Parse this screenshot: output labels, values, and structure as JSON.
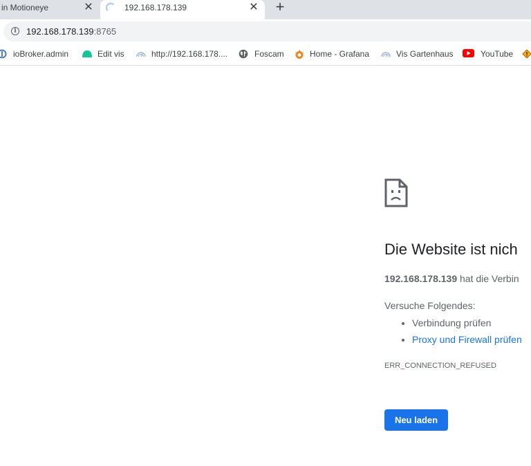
{
  "tabs": [
    {
      "title": "in Motioneye",
      "active": false
    },
    {
      "title": "192.168.178.139",
      "active": true
    }
  ],
  "new_tab_label": "+",
  "address_bar": {
    "host": "192.168.178.139",
    "port": ":8765"
  },
  "bookmarks": [
    {
      "label": "ioBroker.admin",
      "icon": "iobroker-icon"
    },
    {
      "label": "Edit vis",
      "icon": "vis-icon"
    },
    {
      "label": "http://192.168.178....",
      "icon": "gauge-icon"
    },
    {
      "label": "Foscam",
      "icon": "globe-icon"
    },
    {
      "label": "Home - Grafana",
      "icon": "grafana-icon"
    },
    {
      "label": "Vis Gartenhaus",
      "icon": "gauge-icon"
    },
    {
      "label": "YouTube",
      "icon": "youtube-icon"
    }
  ],
  "error_page": {
    "headline": "Die Website ist nich",
    "desc_host": "192.168.178.139",
    "desc_rest": " hat die Verbin",
    "suggestions_label": "Versuche Folgendes:",
    "suggestions": [
      "Verbindung prüfen",
      "Proxy und Firewall prüfen"
    ],
    "error_code": "ERR_CONNECTION_REFUSED",
    "reload_label": "Neu laden"
  },
  "colors": {
    "accent": "#1a73e8",
    "tabstrip": "#dee1e6",
    "text_secondary": "#5f6368"
  }
}
